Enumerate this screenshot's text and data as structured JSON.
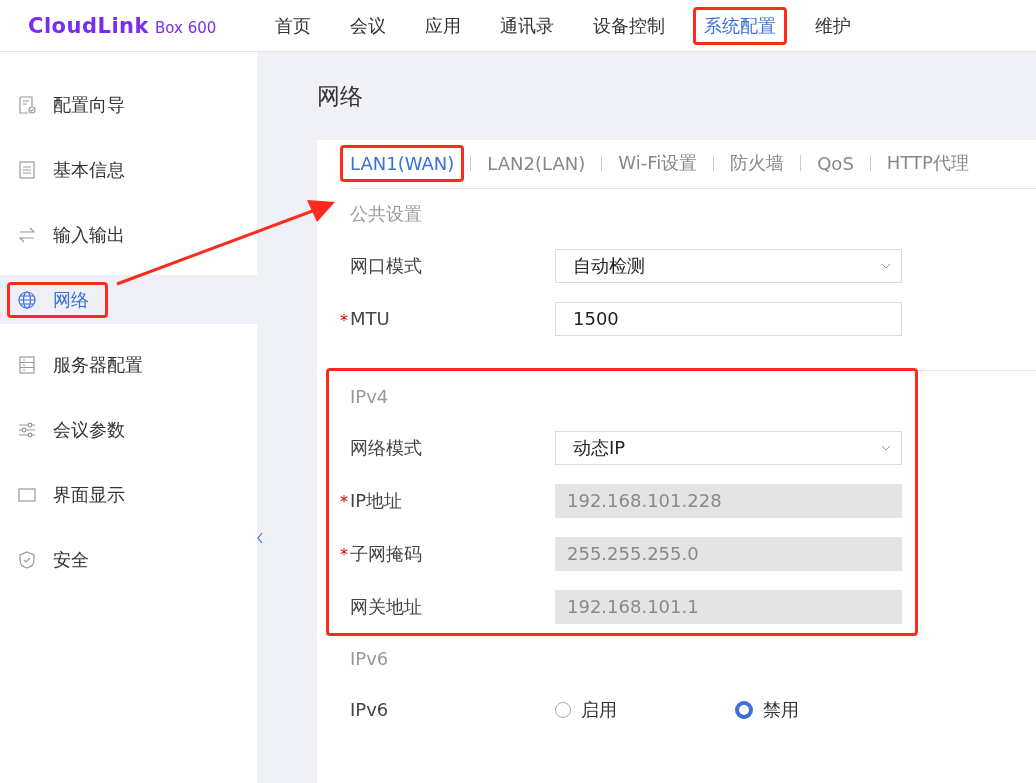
{
  "header": {
    "logo": {
      "brand": "CloudLink",
      "model": "Box 600"
    },
    "nav": [
      {
        "label": "首页",
        "selected": false,
        "highlighted": false
      },
      {
        "label": "会议",
        "selected": false,
        "highlighted": false
      },
      {
        "label": "应用",
        "selected": false,
        "highlighted": false
      },
      {
        "label": "通讯录",
        "selected": false,
        "highlighted": false
      },
      {
        "label": "设备控制",
        "selected": false,
        "highlighted": false
      },
      {
        "label": "系统配置",
        "selected": true,
        "highlighted": true
      },
      {
        "label": "维护",
        "selected": false,
        "highlighted": false
      }
    ]
  },
  "sidebar": {
    "items": [
      {
        "label": "配置向导",
        "selected": false,
        "highlighted": false
      },
      {
        "label": "基本信息",
        "selected": false,
        "highlighted": false
      },
      {
        "label": "输入输出",
        "selected": false,
        "highlighted": false
      },
      {
        "label": "网络",
        "selected": true,
        "highlighted": true
      },
      {
        "label": "服务器配置",
        "selected": false,
        "highlighted": false
      },
      {
        "label": "会议参数",
        "selected": false,
        "highlighted": false
      },
      {
        "label": "界面显示",
        "selected": false,
        "highlighted": false
      },
      {
        "label": "安全",
        "selected": false,
        "highlighted": false
      }
    ]
  },
  "page_title": "网络",
  "tabs": [
    {
      "label": "LAN1(WAN)",
      "selected": true,
      "highlighted": true
    },
    {
      "label": "LAN2(LAN)",
      "selected": false,
      "highlighted": false
    },
    {
      "label": "Wi-Fi设置",
      "selected": false,
      "highlighted": false
    },
    {
      "label": "防火墙",
      "selected": false,
      "highlighted": false
    },
    {
      "label": "QoS",
      "selected": false,
      "highlighted": false
    },
    {
      "label": "HTTP代理",
      "selected": false,
      "highlighted": false
    }
  ],
  "sections": [
    {
      "title": "公共设置",
      "highlighted": false,
      "divider": true,
      "rows": [
        {
          "label": "网口模式",
          "kind": "select",
          "value": "自动检测",
          "disabled": false
        },
        {
          "label": "MTU",
          "kind": "input",
          "required_mark": "*",
          "value": "1500",
          "disabled": false
        }
      ]
    },
    {
      "title": "IPv4",
      "highlighted": true,
      "divider": false,
      "rows": [
        {
          "label": "网络模式",
          "kind": "select",
          "value": "动态IP",
          "disabled": false
        },
        {
          "label": "IP地址",
          "kind": "input",
          "required_mark": "*",
          "value": "192.168.101.228",
          "disabled": true
        },
        {
          "label": "子网掩码",
          "kind": "input",
          "required_mark": "*",
          "value": "255.255.255.0",
          "disabled": true
        },
        {
          "label": "网关地址",
          "kind": "input",
          "value": "192.168.101.1",
          "disabled": true
        }
      ]
    },
    {
      "title": "IPv6",
      "highlighted": false,
      "divider": false,
      "rows": [
        {
          "label": "IPv6",
          "kind": "radio",
          "options": [
            {
              "label": "启用",
              "selected": false
            },
            {
              "label": "禁用",
              "selected": true
            }
          ]
        }
      ]
    }
  ],
  "annotation": {
    "arrow": true
  }
}
